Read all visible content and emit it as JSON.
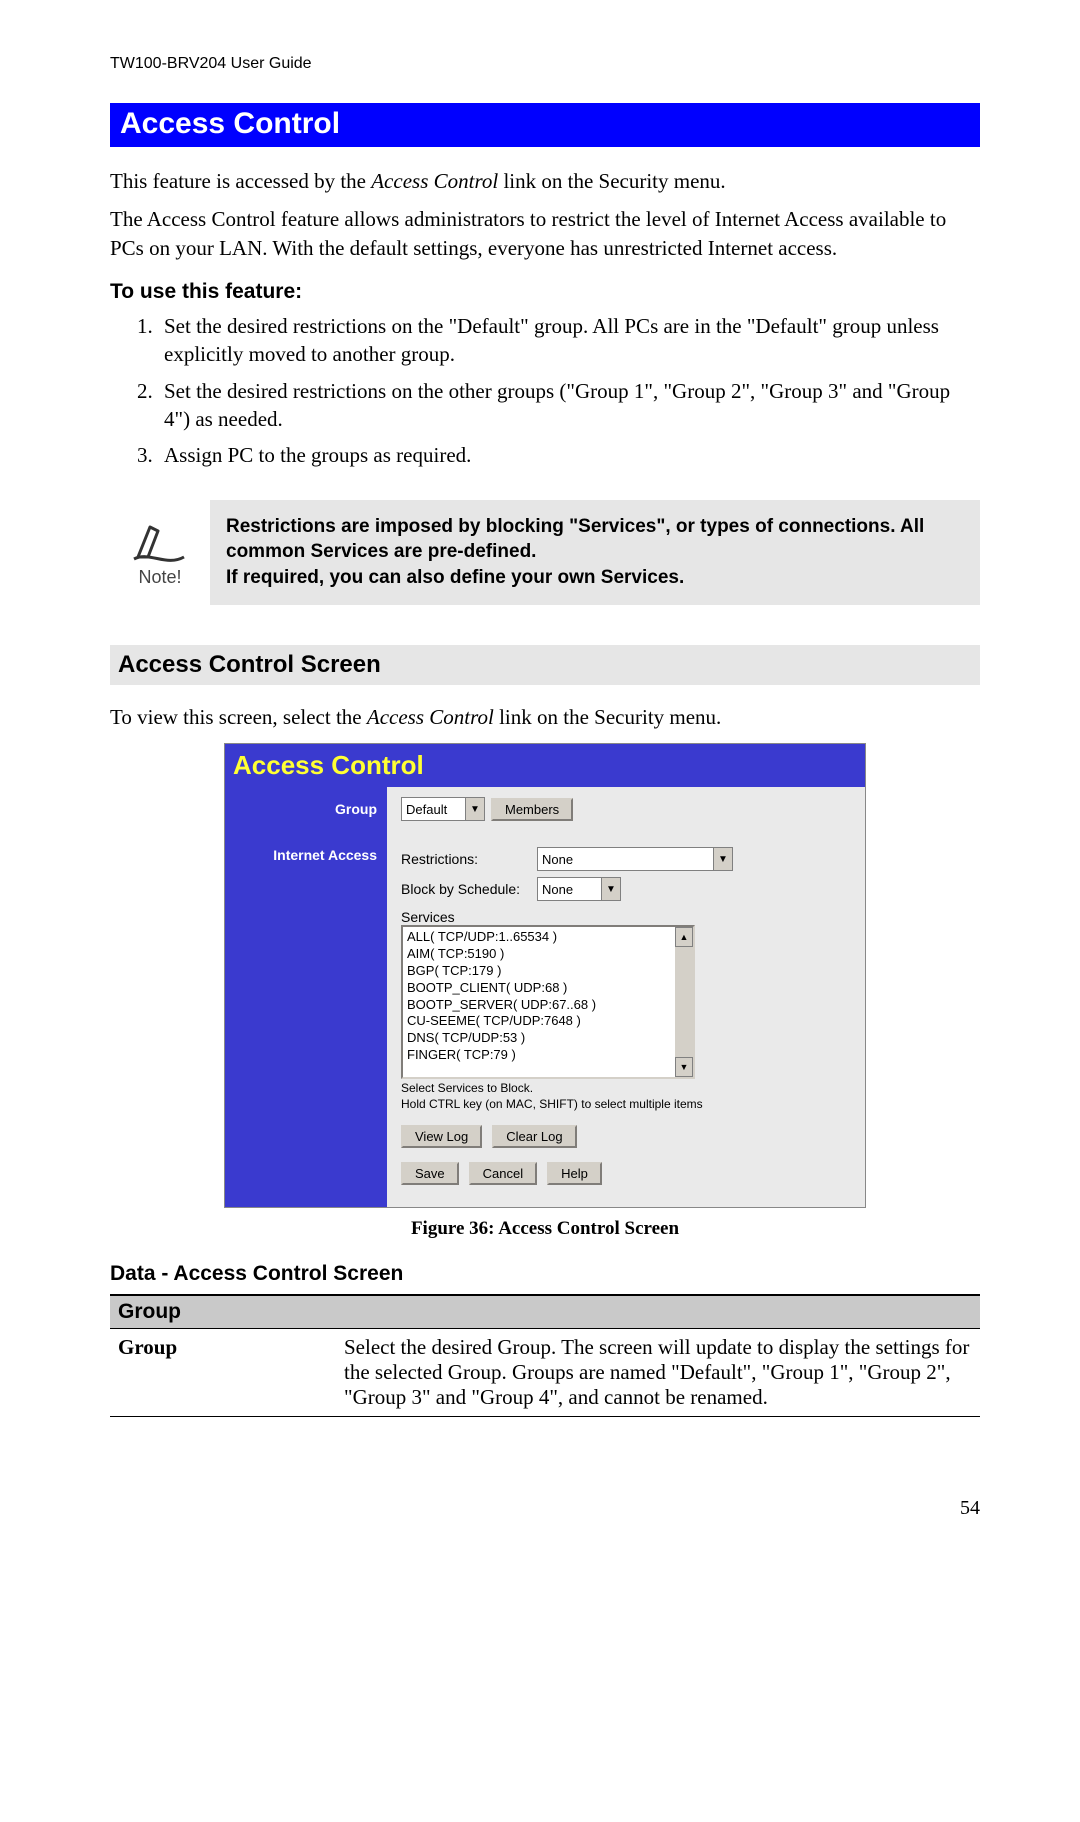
{
  "header": "TW100-BRV204 User Guide",
  "section_title": "Access Control",
  "intro": {
    "p1_pre": "This feature is accessed by the ",
    "p1_em": "Access Control",
    "p1_post": " link on the Security menu.",
    "p2": "The Access Control feature allows administrators to restrict the level of Internet Access available to PCs on your LAN. With the default settings, everyone has unrestricted Internet access."
  },
  "howto_heading": "To use this feature:",
  "steps": [
    "Set the desired restrictions on the \"Default\" group. All PCs are in the \"Default\" group unless explicitly moved to another group.",
    "Set the desired restrictions on the other groups (\"Group 1\", \"Group 2\", \"Group 3\" and \"Group 4\") as needed.",
    "Assign PC to the groups as required."
  ],
  "note": {
    "label": "Note!",
    "line1": "Restrictions are imposed by blocking \"Services\", or types of connections. All common Services are pre-defined.",
    "line2": "If required, you can also define your own Services."
  },
  "screen_heading": "Access Control Screen",
  "screen_intro_pre": "To view this screen, select the ",
  "screen_intro_em": "Access Control",
  "screen_intro_post": " link on the Security menu.",
  "screenshot": {
    "title": "Access Control",
    "nav": {
      "group": "Group",
      "internet": "Internet Access"
    },
    "group_select": "Default",
    "members_btn": "Members",
    "restrictions_label": "Restrictions:",
    "restrictions_value": "None",
    "block_label": "Block by Schedule:",
    "block_value": "None",
    "services_label": "Services",
    "services": [
      "ALL( TCP/UDP:1..65534 )",
      "AIM( TCP:5190 )",
      "BGP( TCP:179 )",
      "BOOTP_CLIENT( UDP:68 )",
      "BOOTP_SERVER( UDP:67..68 )",
      "CU-SEEME( TCP/UDP:7648 )",
      "DNS( TCP/UDP:53 )",
      "FINGER( TCP:79 )"
    ],
    "hint1": "Select Services to Block.",
    "hint2": "Hold CTRL key (on MAC, SHIFT) to select multiple items",
    "buttons": {
      "viewlog": "View Log",
      "clearlog": "Clear Log",
      "save": "Save",
      "cancel": "Cancel",
      "help": "Help"
    }
  },
  "figure_caption": "Figure 36: Access Control Screen",
  "data_heading": "Data - Access Control Screen",
  "table": {
    "section": "Group",
    "row_key": "Group",
    "row_val": "Select the desired Group. The screen will update to display the settings for the selected Group. Groups are named \"Default\", \"Group 1\", \"Group 2\", \"Group 3\" and \"Group 4\", and cannot be renamed."
  },
  "page_number": "54"
}
